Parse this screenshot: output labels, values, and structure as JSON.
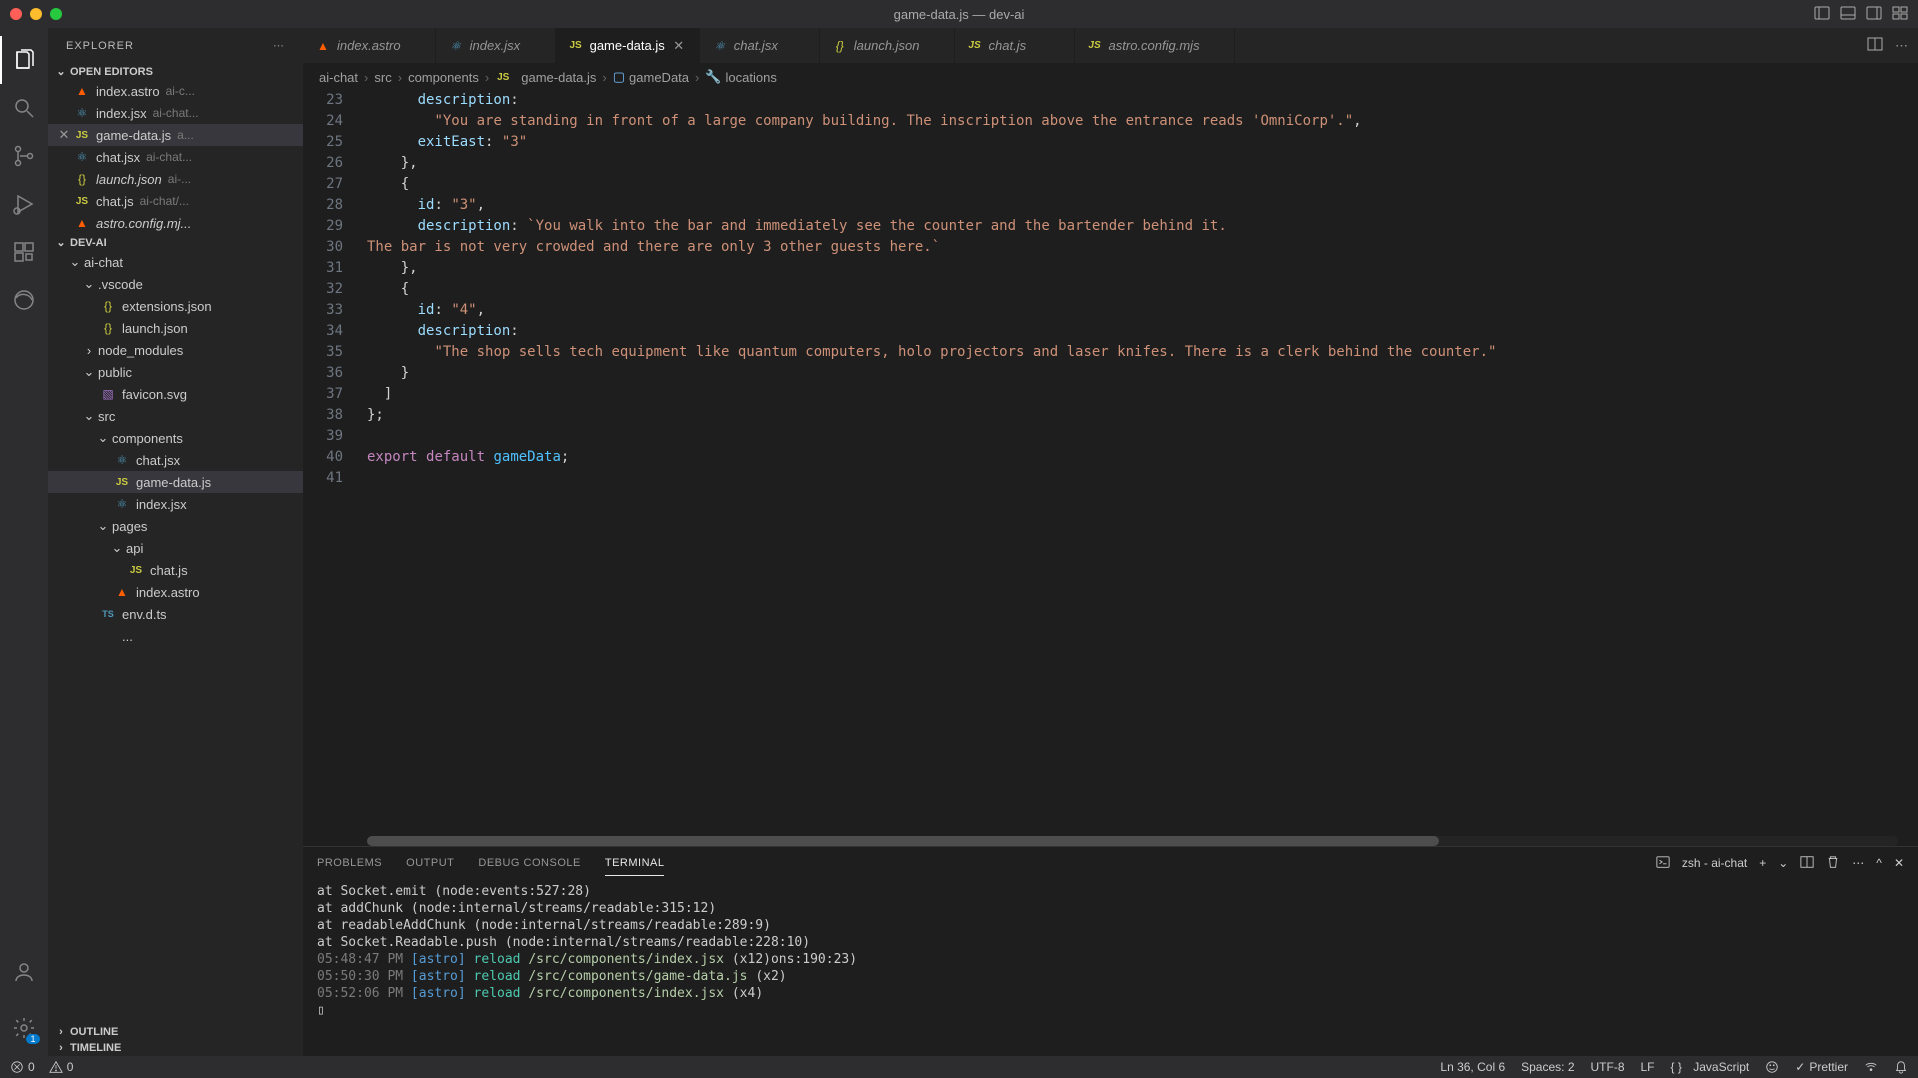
{
  "window": {
    "title": "game-data.js — dev-ai"
  },
  "sidebar": {
    "title": "EXPLORER",
    "sections": {
      "openEditors": {
        "label": "OPEN EDITORS",
        "items": [
          {
            "name": "index.astro",
            "desc": "ai-c..."
          },
          {
            "name": "index.jsx",
            "desc": "ai-chat..."
          },
          {
            "name": "game-data.js",
            "desc": "a..."
          },
          {
            "name": "chat.jsx",
            "desc": "ai-chat..."
          },
          {
            "name": "launch.json",
            "desc": "ai-..."
          },
          {
            "name": "chat.js",
            "desc": "ai-chat/..."
          },
          {
            "name": "astro.config.mj...",
            "desc": ""
          }
        ]
      },
      "project": {
        "label": "DEV-AI"
      },
      "outline": {
        "label": "OUTLINE"
      },
      "timeline": {
        "label": "TIMELINE"
      }
    },
    "tree": {
      "aiChat": "ai-chat",
      "vscode": ".vscode",
      "extensions": "extensions.json",
      "launch": "launch.json",
      "nodeModules": "node_modules",
      "public": "public",
      "favicon": "favicon.svg",
      "src": "src",
      "components": "components",
      "chatJsx": "chat.jsx",
      "gameData": "game-data.js",
      "indexJsx": "index.jsx",
      "pages": "pages",
      "api": "api",
      "chatJs": "chat.js",
      "indexAstro": "index.astro",
      "envDts": "env.d.ts",
      "more": "..."
    }
  },
  "tabs": [
    {
      "name": "index.astro",
      "icon": "astro"
    },
    {
      "name": "index.jsx",
      "icon": "jsx"
    },
    {
      "name": "game-data.js",
      "icon": "js",
      "active": true
    },
    {
      "name": "chat.jsx",
      "icon": "jsx"
    },
    {
      "name": "launch.json",
      "icon": "json"
    },
    {
      "name": "chat.js",
      "icon": "js"
    },
    {
      "name": "astro.config.mjs",
      "icon": "js"
    }
  ],
  "breadcrumbs": {
    "p0": "ai-chat",
    "p1": "src",
    "p2": "components",
    "p3": "game-data.js",
    "p4": "gameData",
    "p5": "locations"
  },
  "code": {
    "startLine": 23,
    "lines": [
      {
        "n": 23,
        "html": "      <span class='tok-prop'>description</span><span class='tok-punc'>:</span>"
      },
      {
        "n": 24,
        "html": "        <span class='tok-str'>\"You are standing in front of a large company building. The inscription above the entrance reads 'OmniCorp'.\"</span><span class='tok-punc'>,</span>"
      },
      {
        "n": 25,
        "html": "      <span class='tok-prop'>exitEast</span><span class='tok-punc'>:</span> <span class='tok-str'>\"3\"</span>"
      },
      {
        "n": 26,
        "html": "    <span class='tok-punc'>},</span>"
      },
      {
        "n": 27,
        "html": "    <span class='tok-punc'>{</span>"
      },
      {
        "n": 28,
        "html": "      <span class='tok-prop'>id</span><span class='tok-punc'>:</span> <span class='tok-str'>\"3\"</span><span class='tok-punc'>,</span>"
      },
      {
        "n": 29,
        "html": "      <span class='tok-prop'>description</span><span class='tok-punc'>:</span> <span class='tok-str'>`You walk into the bar and immediately see the counter and the bartender behind it.</span>"
      },
      {
        "n": 30,
        "html": "<span class='tok-str'>The bar is not very crowded and there are only 3 other guests here.`</span>"
      },
      {
        "n": 31,
        "html": "    <span class='tok-punc'>},</span>"
      },
      {
        "n": 32,
        "html": "    <span class='tok-punc'>{</span>"
      },
      {
        "n": 33,
        "html": "      <span class='tok-prop'>id</span><span class='tok-punc'>:</span> <span class='tok-str'>\"4\"</span><span class='tok-punc'>,</span>"
      },
      {
        "n": 34,
        "html": "      <span class='tok-prop'>description</span><span class='tok-punc'>:</span>"
      },
      {
        "n": 35,
        "html": "        <span class='tok-str'>\"The shop sells tech equipment like quantum computers, holo projectors and laser knifes. There is a clerk behind the counter.\"</span>"
      },
      {
        "n": 36,
        "html": "    <span class='tok-punc'>}</span>"
      },
      {
        "n": 37,
        "html": "  <span class='tok-punc'>]</span>"
      },
      {
        "n": 38,
        "html": "<span class='tok-punc'>};</span>"
      },
      {
        "n": 39,
        "html": ""
      },
      {
        "n": 40,
        "html": "<span class='tok-kw'>export</span> <span class='tok-kw'>default</span> <span class='tok-var'>gameData</span><span class='tok-punc'>;</span>"
      },
      {
        "n": 41,
        "html": ""
      }
    ]
  },
  "panel": {
    "tabs": {
      "problems": "PROBLEMS",
      "output": "OUTPUT",
      "debug": "DEBUG CONSOLE",
      "terminal": "TERMINAL"
    },
    "shell": "zsh - ai-chat",
    "lines": [
      "    at Socket.emit (node:events:527:28)",
      "    at addChunk (node:internal/streams/readable:315:12)",
      "    at readableAddChunk (node:internal/streams/readable:289:9)",
      "    at Socket.Readable.push (node:internal/streams/readable:228:10)"
    ],
    "reloads": [
      {
        "time": "05:48:47 PM",
        "path": "/src/components/index.jsx",
        "suffix": "(x12)ons:190:23)"
      },
      {
        "time": "05:50:30 PM",
        "path": "/src/components/game-data.js",
        "suffix": "(x2)"
      },
      {
        "time": "05:52:06 PM",
        "path": "/src/components/index.jsx",
        "suffix": "(x4)"
      }
    ],
    "astroTag": "[astro]",
    "reloadWord": "reload"
  },
  "statusbar": {
    "errors": "0",
    "warnings": "0",
    "lnCol": "Ln 36, Col 6",
    "spaces": "Spaces: 2",
    "encoding": "UTF-8",
    "eol": "LF",
    "lang": "JavaScript",
    "prettier": "Prettier"
  }
}
